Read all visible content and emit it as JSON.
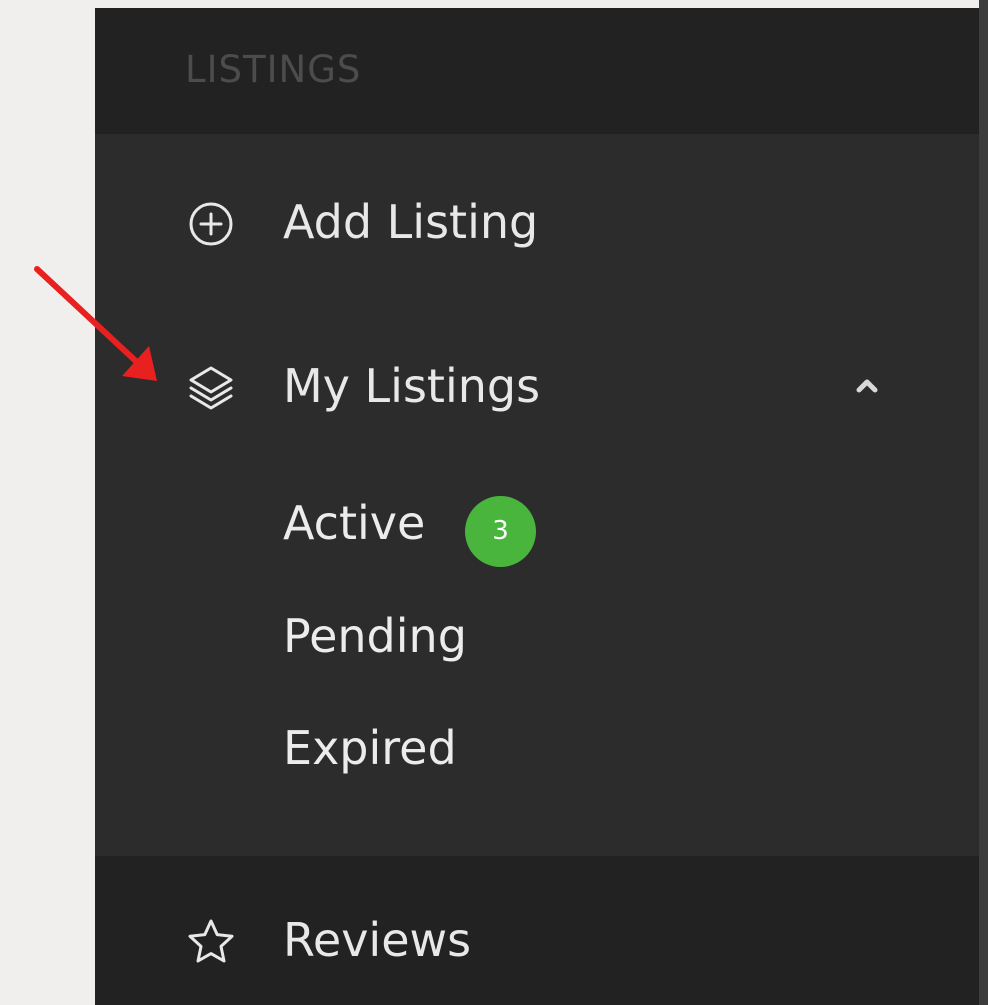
{
  "sidebar": {
    "section_title": "LISTINGS",
    "items": {
      "add_listing": {
        "label": "Add Listing",
        "icon": "plus-circle-icon"
      },
      "my_listings": {
        "label": "My Listings",
        "icon": "layers-icon",
        "expanded": true,
        "sub_items": {
          "active": {
            "label": "Active",
            "count": "3"
          },
          "pending": {
            "label": "Pending"
          },
          "expired": {
            "label": "Expired"
          }
        }
      },
      "reviews": {
        "label": "Reviews",
        "icon": "star-icon"
      }
    }
  },
  "colors": {
    "sidebar_bg": "#2c2c2c",
    "header_bg": "#222222",
    "text": "#e8e8e8",
    "badge": "#4ab53d",
    "annotation_arrow": "#e8201f"
  }
}
